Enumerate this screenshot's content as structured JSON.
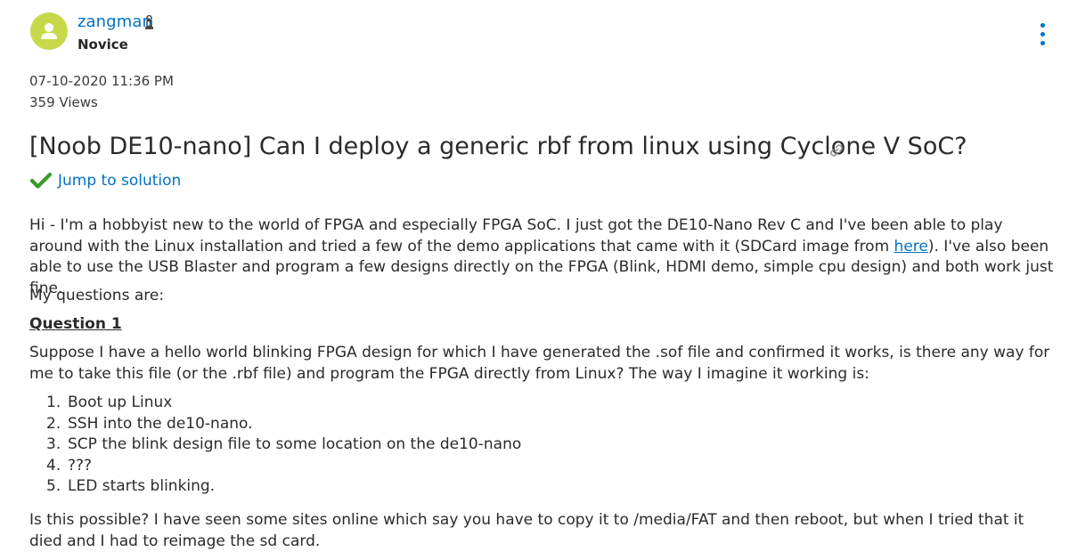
{
  "post": {
    "author": {
      "name": "zangman",
      "rank": "Novice"
    },
    "date": "07-10-2020 11:36 PM",
    "views": "359 Views",
    "title": "[Noob DE10-nano] Can I deploy a generic rbf from linux using Cyclone V SoC?",
    "jump_to_solution": "Jump to solution",
    "body": {
      "p1_before_link": "Hi - I'm a hobbyist new to the world of FPGA and especially FPGA SoC. I just got the DE10-Nano Rev C and I've been able to play around with the Linux installation and tried a few of the demo applications that came with it (SDCard image from ",
      "p1_link": "here",
      "p1_after_link": "). I've also been able to use the USB Blaster and program a few designs directly on the FPGA (Blink, HDMI demo, simple cpu design) and both work just fine.",
      "p2": "My questions are:",
      "question_heading": "Question 1",
      "p3": "Suppose I have a hello world blinking FPGA design for which I have generated the .sof file and confirmed it works, is there any way for me to take this file (or the .rbf file) and program the FPGA directly from Linux? The way I imagine it working is:",
      "steps": [
        {
          "num": "1.",
          "text": "Boot up Linux"
        },
        {
          "num": "2.",
          "text": "SSH into the de10-nano."
        },
        {
          "num": "3.",
          "text": "SCP the blink design file to some location on the de10-nano"
        },
        {
          "num": "4.",
          "text": "???"
        },
        {
          "num": "5.",
          "text": "LED starts blinking."
        }
      ],
      "p4": "Is this possible? I have seen some sites online which say you have to copy it to /media/FAT and then reboot, but when I tried that it died and I had to reimage the sd card."
    }
  },
  "icons": {
    "avatar": "user-avatar-icon",
    "rank": "rank-badge-icon",
    "menu": "kebab-menu-icon",
    "link": "link-icon",
    "check": "checkmark-icon"
  },
  "colors": {
    "link": "#0071c5",
    "check": "#3a9a2a",
    "avatar_bg": "#c7d94a",
    "text": "#2b2b2b"
  }
}
